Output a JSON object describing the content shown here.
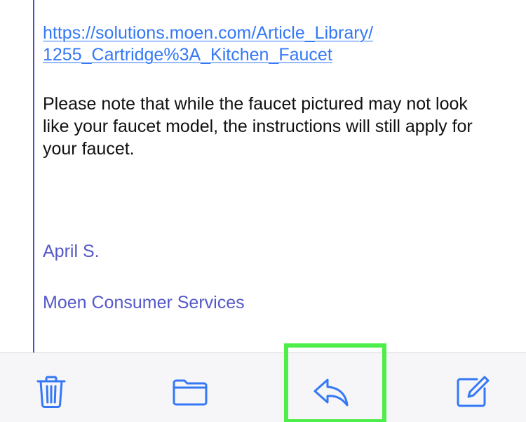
{
  "email": {
    "link_line1": "https://solutions.moen.com/Article_Library/",
    "link_line2": "1255_Cartridge%3A_Kitchen_Faucet",
    "paragraph_line1": "Please note that while the faucet pictured may not look",
    "paragraph_line2": "like your faucet model, the instructions will still apply for",
    "paragraph_line3": "your faucet.",
    "signature_name": "April S.",
    "signature_org": "Moen Consumer Services"
  },
  "toolbar": {
    "buttons": [
      {
        "icon": "trash-icon"
      },
      {
        "icon": "folder-icon"
      },
      {
        "icon": "reply-icon"
      },
      {
        "icon": "compose-icon"
      }
    ]
  },
  "colors": {
    "link": "#3478f6",
    "toolbar_icon": "#3478f6",
    "quote_bar": "#4a4fc4",
    "signature": "#5458c8",
    "highlight": "#4ded4a"
  }
}
